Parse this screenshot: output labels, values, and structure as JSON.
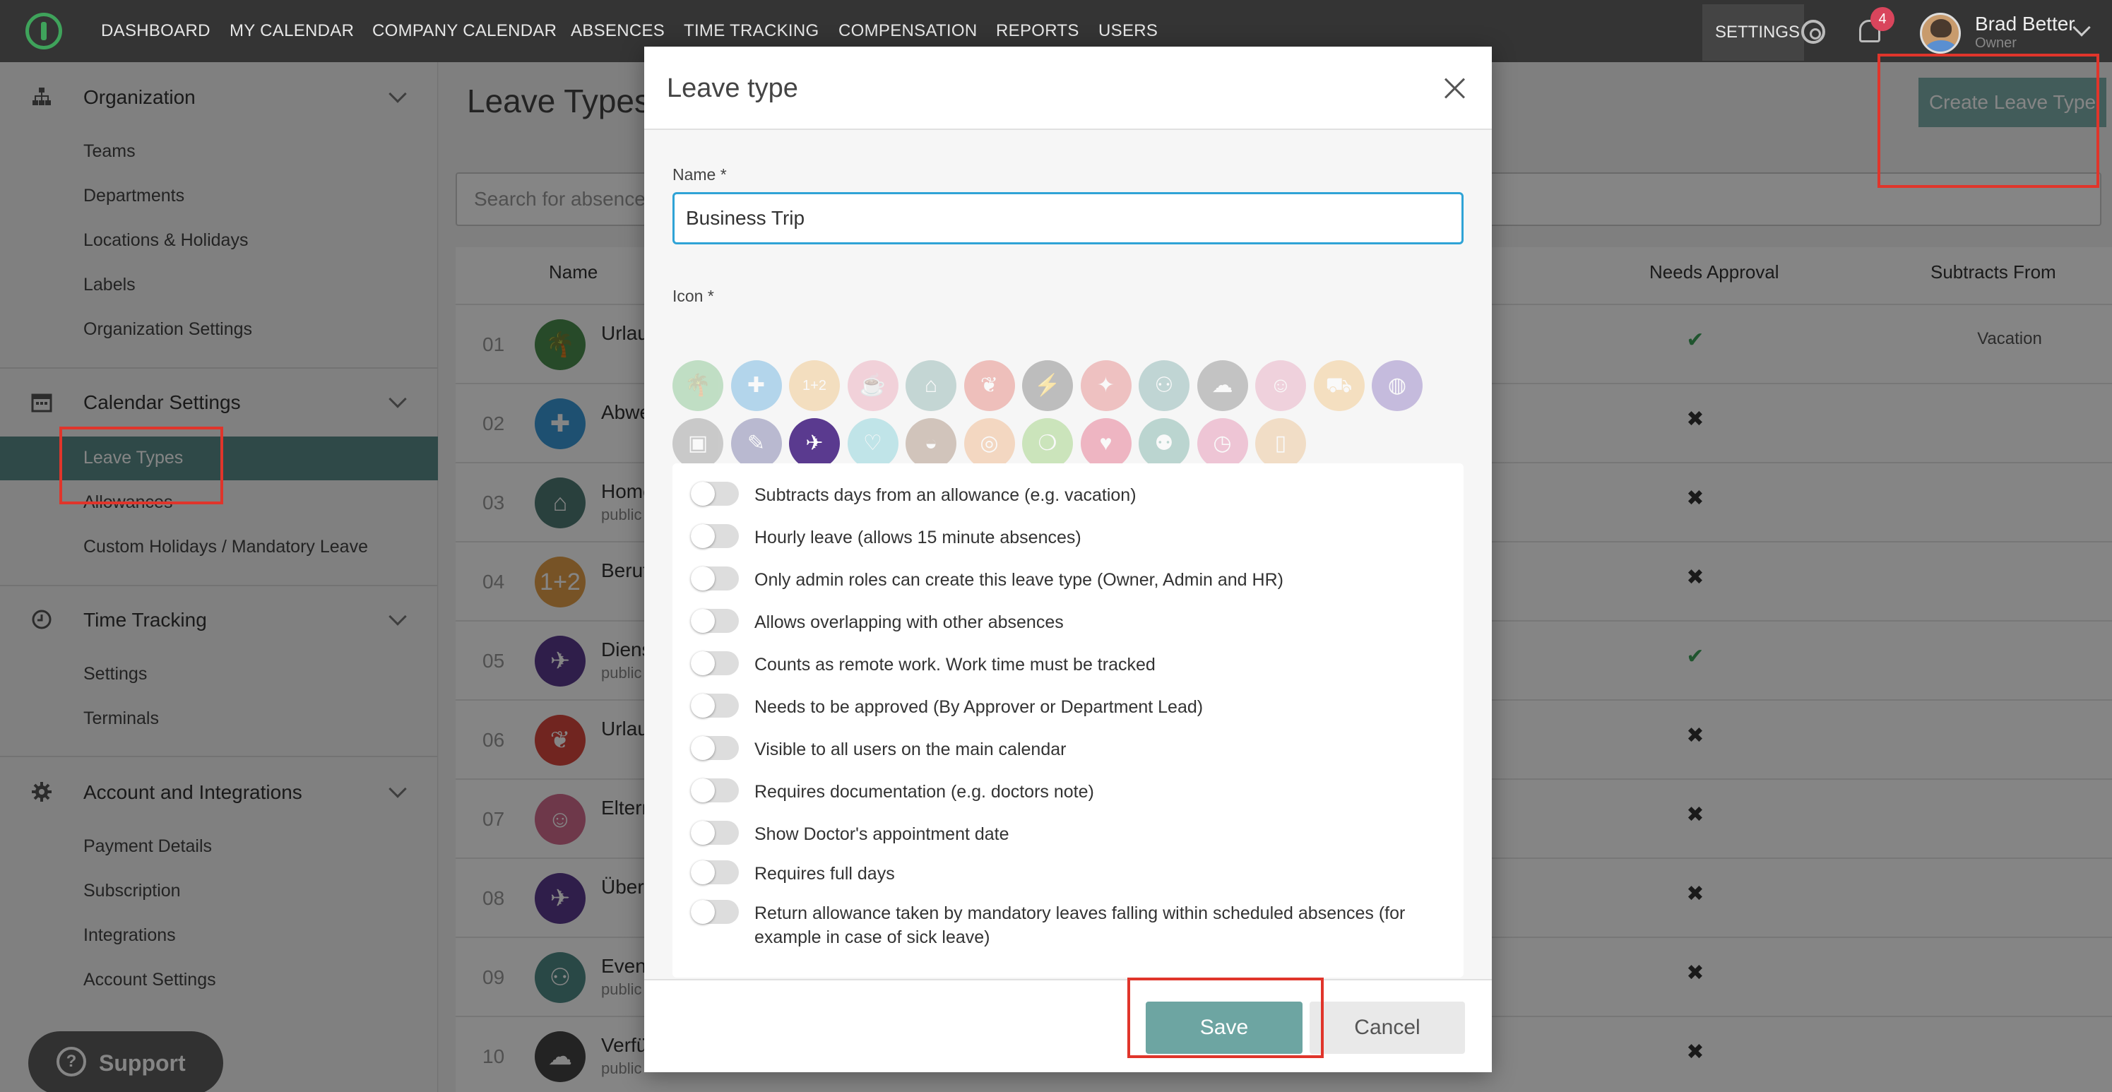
{
  "topnav": {
    "items": [
      "DASHBOARD",
      "MY CALENDAR",
      "COMPANY CALENDAR",
      "ABSENCES",
      "TIME TRACKING",
      "COMPENSATION",
      "REPORTS",
      "USERS"
    ],
    "settings_label": "SETTINGS",
    "notification_count": "4",
    "user_name": "Brad Better",
    "user_role": "Owner"
  },
  "sidebar": {
    "organization": {
      "title": "Organization",
      "items": [
        "Teams",
        "Departments",
        "Locations & Holidays",
        "Labels",
        "Organization Settings"
      ]
    },
    "calendar_settings": {
      "title": "Calendar Settings",
      "items": [
        "Leave Types",
        "Allowances",
        "Custom Holidays / Mandatory Leave"
      ],
      "active": "Leave Types"
    },
    "time_tracking": {
      "title": "Time Tracking",
      "items": [
        "Settings",
        "Terminals"
      ]
    },
    "account": {
      "title": "Account and Integrations",
      "items": [
        "Payment Details",
        "Subscription",
        "Integrations",
        "Account Settings"
      ]
    },
    "support_label": "Support"
  },
  "main": {
    "title": "Leave Types",
    "create_button": "Create Leave Type",
    "search_placeholder": "Search for absence types",
    "columns": [
      "Name",
      "Needs Approval",
      "Subtracts From"
    ],
    "rows": [
      {
        "num": "01",
        "name": "Urlaub",
        "sub": "",
        "approval": "✔",
        "approval_color": "#3fa35b",
        "subtracts": "Vacation",
        "icon": "palm-icon",
        "glyph": "🌴",
        "color": "#4c8f4f"
      },
      {
        "num": "02",
        "name": "Abwesenheit",
        "sub": "",
        "approval": "✖",
        "approval_color": "#333333",
        "subtracts": "",
        "icon": "plus-icon",
        "glyph": "✚",
        "color": "#3a9ad9"
      },
      {
        "num": "03",
        "name": "Homeoffice",
        "sub": "public",
        "approval": "✖",
        "approval_color": "#333333",
        "subtracts": "",
        "icon": "home-icon",
        "glyph": "⌂",
        "color": "#4f7b76"
      },
      {
        "num": "04",
        "name": "Berufsschule",
        "sub": "",
        "approval": "✖",
        "approval_color": "#333333",
        "subtracts": "",
        "icon": "school-icon",
        "glyph": "1+2",
        "color": "#e5a04a"
      },
      {
        "num": "05",
        "name": "Dienstreise",
        "sub": "public",
        "approval": "✔",
        "approval_color": "#3fa35b",
        "subtracts": "",
        "icon": "plane-icon",
        "glyph": "✈",
        "color": "#5a3a8f"
      },
      {
        "num": "06",
        "name": "Urlaub",
        "sub": "",
        "approval": "✖",
        "approval_color": "#333333",
        "subtracts": "",
        "icon": "leaf-icon",
        "glyph": "❦",
        "color": "#d9473f"
      },
      {
        "num": "07",
        "name": "Elternzeit",
        "sub": "",
        "approval": "✖",
        "approval_color": "#333333",
        "subtracts": "",
        "icon": "baby-icon",
        "glyph": "☺",
        "color": "#d36b8f"
      },
      {
        "num": "08",
        "name": "Überstunden",
        "sub": "",
        "approval": "✖",
        "approval_color": "#333333",
        "subtracts": "",
        "icon": "plane-icon",
        "glyph": "✈",
        "color": "#5a3a8f"
      },
      {
        "num": "09",
        "name": "Event",
        "sub": "public",
        "approval": "✖",
        "approval_color": "#333333",
        "subtracts": "",
        "icon": "group-icon",
        "glyph": "⚇",
        "color": "#4f8a86"
      },
      {
        "num": "10",
        "name": "Verfügbar",
        "sub": "public",
        "approval": "✖",
        "approval_color": "#333333",
        "subtracts": "",
        "icon": "thought-icon",
        "glyph": "☁",
        "color": "#444444"
      }
    ]
  },
  "modal": {
    "title": "Leave type",
    "name_label": "Name *",
    "name_value": "Business Trip",
    "icon_label": "Icon *",
    "icons": [
      {
        "name": "palm-icon",
        "glyph": "🌴",
        "color": "#5fb36a",
        "selected": false
      },
      {
        "name": "plus-icon",
        "glyph": "✚",
        "color": "#3a9ad9",
        "selected": false
      },
      {
        "name": "school-icon",
        "glyph": "1+2",
        "color": "#f0b25a",
        "selected": false
      },
      {
        "name": "coffee-icon",
        "glyph": "☕",
        "color": "#e88fa6",
        "selected": false
      },
      {
        "name": "home-icon",
        "glyph": "⌂",
        "color": "#6a9c97",
        "selected": false
      },
      {
        "name": "leaf-icon",
        "glyph": "❦",
        "color": "#e05a50",
        "selected": false
      },
      {
        "name": "switch-icon",
        "glyph": "⚡",
        "color": "#555555",
        "selected": false
      },
      {
        "name": "dinner-icon",
        "glyph": "✦",
        "color": "#e06060",
        "selected": false
      },
      {
        "name": "group-icon",
        "glyph": "⚇",
        "color": "#5e9a96",
        "selected": false
      },
      {
        "name": "thought-icon",
        "glyph": "☁",
        "color": "#666666",
        "selected": false
      },
      {
        "name": "baby-icon",
        "glyph": "☺",
        "color": "#e48fae",
        "selected": false
      },
      {
        "name": "car-icon",
        "glyph": "⛟",
        "color": "#f2b55f",
        "selected": false
      },
      {
        "name": "globe-icon",
        "glyph": "◍",
        "color": "#6d4fb0",
        "selected": false
      },
      {
        "name": "wallet-icon",
        "glyph": "▣",
        "color": "#777777",
        "selected": false
      },
      {
        "name": "eraser-icon",
        "glyph": "✎",
        "color": "#4a4a8a",
        "selected": false
      },
      {
        "name": "plane-icon",
        "glyph": "✈",
        "color": "#5a3a8f",
        "selected": true
      },
      {
        "name": "heartbeat-icon",
        "glyph": "♡",
        "color": "#5fc3cf",
        "selected": false
      },
      {
        "name": "cake-icon",
        "glyph": "◒",
        "color": "#8f6a4f",
        "selected": false
      },
      {
        "name": "rings-icon",
        "glyph": "◎",
        "color": "#f0a060",
        "selected": false
      },
      {
        "name": "apple-icon",
        "glyph": "❍",
        "color": "#7cc34f",
        "selected": false
      },
      {
        "name": "heart-icon",
        "glyph": "♥",
        "color": "#e03f63",
        "selected": false
      },
      {
        "name": "family-icon",
        "glyph": "⚉",
        "color": "#4f9a8a",
        "selected": false
      },
      {
        "name": "clock-icon",
        "glyph": "◷",
        "color": "#e06b9a",
        "selected": false
      },
      {
        "name": "beer-icon",
        "glyph": "▯",
        "color": "#e8b070",
        "selected": false
      }
    ],
    "options": [
      "Subtracts days from an allowance (e.g. vacation)",
      "Hourly leave (allows 15 minute absences)",
      "Only admin roles can create this leave type (Owner, Admin and HR)",
      "Allows overlapping with other absences",
      "Counts as remote work. Work time must be tracked",
      "Needs to be approved (By Approver or Department Lead)",
      "Visible to all users on the main calendar",
      "Requires documentation (e.g. doctors note)",
      "Show Doctor's appointment date",
      "Requires full days",
      "Return allowance taken by mandatory leaves falling within scheduled absences (for example in case of sick leave)"
    ],
    "save_label": "Save",
    "cancel_label": "Cancel"
  }
}
